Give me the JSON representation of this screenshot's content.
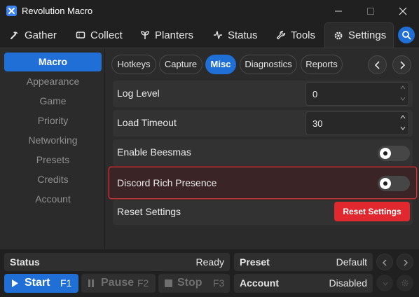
{
  "window": {
    "title": "Revolution Macro"
  },
  "tabs": [
    {
      "label": "Gather",
      "icon": "pickaxe-icon"
    },
    {
      "label": "Collect",
      "icon": "ticket-icon"
    },
    {
      "label": "Planters",
      "icon": "sprout-icon"
    },
    {
      "label": "Status",
      "icon": "pulse-icon"
    },
    {
      "label": "Tools",
      "icon": "wrench-icon"
    },
    {
      "label": "Settings",
      "icon": "gear-icon",
      "active": true
    }
  ],
  "sidebar": {
    "items": [
      {
        "label": "Macro",
        "active": true
      },
      {
        "label": "Appearance"
      },
      {
        "label": "Game"
      },
      {
        "label": "Priority"
      },
      {
        "label": "Networking"
      },
      {
        "label": "Presets"
      },
      {
        "label": "Credits"
      },
      {
        "label": "Account"
      }
    ]
  },
  "subtabs": [
    {
      "label": "Hotkeys"
    },
    {
      "label": "Capture"
    },
    {
      "label": "Misc",
      "active": true
    },
    {
      "label": "Diagnostics"
    },
    {
      "label": "Reports"
    }
  ],
  "settings": {
    "log_level": {
      "label": "Log Level",
      "value": "0"
    },
    "load_timeout": {
      "label": "Load Timeout",
      "value": "30"
    },
    "enable_beesmas": {
      "label": "Enable Beesmas",
      "enabled": false
    },
    "discord_rich_presence": {
      "label": "Discord Rich Presence",
      "enabled": false
    },
    "reset_settings": {
      "label": "Reset Settings",
      "button_label": "Reset Settings"
    }
  },
  "status_bar": {
    "status_label": "Status",
    "status_value": "Ready",
    "preset_label": "Preset",
    "preset_value": "Default",
    "account_label": "Account",
    "account_value": "Disabled"
  },
  "controls": {
    "start_label": "Start",
    "start_key": "F1",
    "pause_label": "Pause",
    "pause_key": "F2",
    "stop_label": "Stop",
    "stop_key": "F3"
  },
  "colors": {
    "accent": "#1f6fd6",
    "danger": "#e0282e",
    "background": "#202020",
    "panel": "#2b2b2b"
  }
}
